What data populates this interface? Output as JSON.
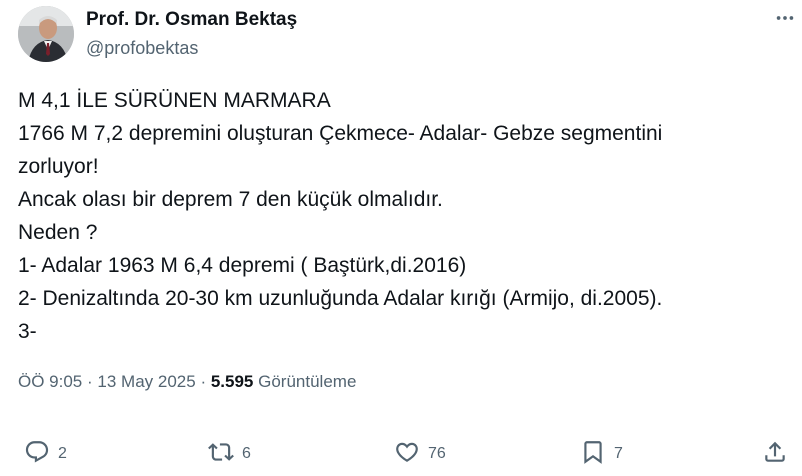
{
  "author": {
    "name": "Prof. Dr. Osman Bektaş",
    "handle": "@profobektas"
  },
  "tweet": {
    "lines": [
      "M 4,1 İLE SÜRÜNEN MARMARA",
      "1766 M 7,2 depremini oluşturan Çekmece- Adalar- Gebze segmentini",
      "zorluyor!",
      "Ancak olası bir deprem 7 den küçük olmalıdır.",
      "Neden ?",
      "1- Adalar 1963 M 6,4 depremi ( Baştürk,di.2016)",
      "2- Denizaltında 20-30 km uzunluğunda Adalar kırığı (Armijo, di.2005).",
      "3-"
    ]
  },
  "meta": {
    "time": "ÖÖ 9:05",
    "separator": "·",
    "date": "13 May 2025",
    "views_count": "5.595",
    "views_label": "Görüntüleme"
  },
  "actions": {
    "replies": "2",
    "reposts": "6",
    "likes": "76",
    "bookmarks": "7"
  },
  "icons": {
    "more": "more-icon",
    "reply": "reply-icon",
    "repost": "repost-icon",
    "like": "heart-icon",
    "bookmark": "bookmark-icon",
    "share": "share-icon"
  },
  "colors": {
    "text": "#0f1419",
    "secondary": "#536471"
  }
}
